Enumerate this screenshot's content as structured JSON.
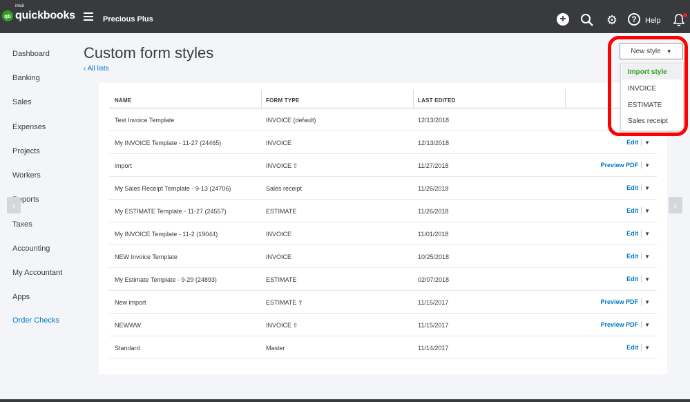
{
  "brand": {
    "intuit": "intuit",
    "name": "quickbooks",
    "badge": "qb"
  },
  "company": "Precious Plus",
  "header": {
    "help": "Help"
  },
  "sidebar": {
    "items": [
      "Dashboard",
      "Banking",
      "Sales",
      "Expenses",
      "Projects",
      "Workers",
      "Reports",
      "Taxes",
      "Accounting",
      "My Accountant",
      "Apps",
      "Order Checks"
    ]
  },
  "page": {
    "title": "Custom form styles",
    "back_link": "All lists"
  },
  "new_style": {
    "label": "New style",
    "options": [
      "Import style",
      "INVOICE",
      "ESTIMATE",
      "Sales receipt"
    ]
  },
  "table": {
    "columns": [
      "NAME",
      "FORM TYPE",
      "LAST EDITED"
    ],
    "rows": [
      {
        "name": "Test Invoice Template",
        "type": "INVOICE (default)",
        "date": "12/13/2018",
        "action": ""
      },
      {
        "name": "My INVOICE Template - 11-27 (24465)",
        "type": "INVOICE",
        "date": "12/13/2018",
        "action": "Edit"
      },
      {
        "name": "import",
        "type": "INVOICE",
        "date": "11/27/2018",
        "action": "Preview PDF"
      },
      {
        "name": "My Sales Receipt Template - 9-13 (24706)",
        "type": "Sales receipt",
        "date": "11/26/2018",
        "action": "Edit"
      },
      {
        "name": "My ESTIMATE Template - 11-27 (24557)",
        "type": "ESTIMATE",
        "date": "11/26/2018",
        "action": "Edit"
      },
      {
        "name": "My INVOICE Template - 11-2 (19044)",
        "type": "INVOICE",
        "date": "11/01/2018",
        "action": "Edit"
      },
      {
        "name": "NEW Invoice Template",
        "type": "INVOICE",
        "date": "10/25/2018",
        "action": "Edit"
      },
      {
        "name": "My Estimate Template - 9-29 (24893)",
        "type": "ESTIMATE",
        "date": "02/07/2018",
        "action": "Edit"
      },
      {
        "name": "New import",
        "type": "ESTIMATE",
        "date": "11/15/2017",
        "action": "Preview PDF"
      },
      {
        "name": "NEWWW",
        "type": "INVOICE",
        "date": "11/15/2017",
        "action": "Preview PDF"
      },
      {
        "name": "Standard",
        "type": "Master",
        "date": "11/14/2017",
        "action": "Edit"
      }
    ]
  },
  "colors": {
    "topbar": "#393a3d",
    "link": "#0077c5",
    "green": "#2ca01c",
    "annotation": "#ff0000"
  }
}
